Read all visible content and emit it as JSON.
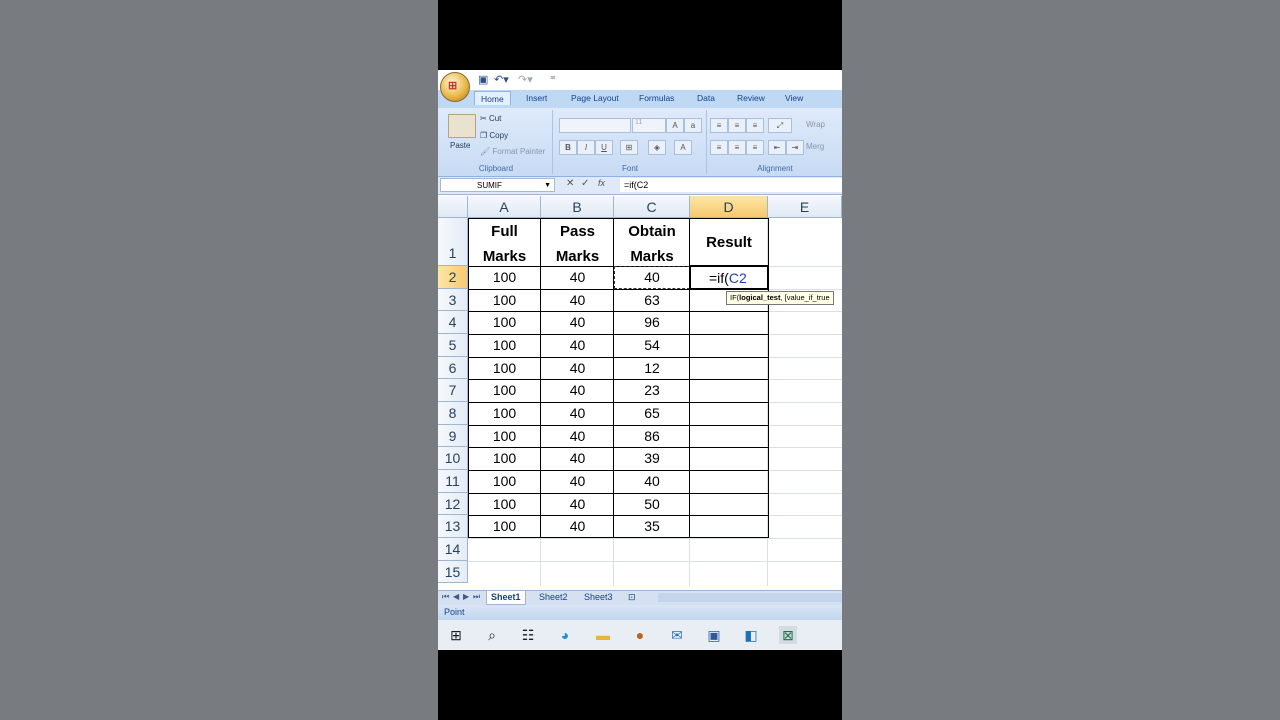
{
  "qat": {
    "customize": "⁼"
  },
  "ribbon": {
    "tabs": [
      "Home",
      "Insert",
      "Page Layout",
      "Formulas",
      "Data",
      "Review",
      "View"
    ],
    "clipboard": {
      "paste": "Paste",
      "cut": "Cut",
      "copy": "Copy",
      "format_painter": "Format Painter",
      "label": "Clipboard"
    },
    "font": {
      "size": "11",
      "label": "Font"
    },
    "alignment": {
      "wrap": "Wrap",
      "merge": "Merg",
      "label": "Alignment"
    }
  },
  "formula_bar": {
    "name_box": "SUMIF",
    "fx": "fx",
    "formula": "=if(C2"
  },
  "columns": [
    "A",
    "B",
    "C",
    "D",
    "E"
  ],
  "rows": [
    "1",
    "2",
    "3",
    "4",
    "5",
    "6",
    "7",
    "8",
    "9",
    "10",
    "11",
    "12",
    "13",
    "14",
    "15"
  ],
  "table": {
    "headers": {
      "a_line1": "Full",
      "a_line2": "Marks",
      "b_line1": "Pass",
      "b_line2": "Marks",
      "c_line1": "Obtain",
      "c_line2": "Marks",
      "d": "Result"
    },
    "full_marks": [
      "100",
      "100",
      "100",
      "100",
      "100",
      "100",
      "100",
      "100",
      "100",
      "100",
      "100",
      "100"
    ],
    "pass_marks": [
      "40",
      "40",
      "40",
      "40",
      "40",
      "40",
      "40",
      "40",
      "40",
      "40",
      "40",
      "40"
    ],
    "obtain_marks": [
      "40",
      "63",
      "96",
      "54",
      "12",
      "23",
      "65",
      "86",
      "39",
      "40",
      "50",
      "35"
    ]
  },
  "editing": {
    "formula_prefix": "=if(",
    "formula_ref": "C2",
    "ref_color": "#1f3fae"
  },
  "tooltip": {
    "fn": "IF(",
    "arg1": "logical_test",
    "rest": ", [value_if_true"
  },
  "sheets": [
    "Sheet1",
    "Sheet2",
    "Sheet3"
  ],
  "status": "Point",
  "taskbar_icons": [
    "windows-icon",
    "search-icon",
    "taskview-icon",
    "edge-icon",
    "explorer-icon",
    "app-icon",
    "mail-icon",
    "media-icon",
    "app2-icon",
    "excel-icon"
  ]
}
